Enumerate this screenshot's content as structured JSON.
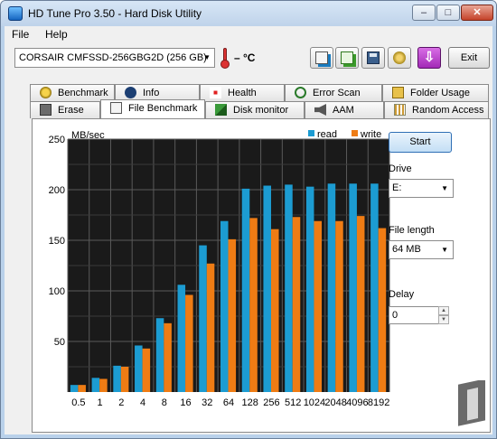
{
  "window": {
    "title": "HD Tune Pro 3.50 - Hard Disk Utility"
  },
  "menu": {
    "file": "File",
    "help": "Help"
  },
  "toolbar": {
    "drive": "CORSAIR CMFSSD-256GBG2D (256 GB)",
    "temperature": "– °C",
    "exit_label": "Exit"
  },
  "tabs_top": [
    {
      "label": "Benchmark",
      "icon": "benchmark-icon"
    },
    {
      "label": "Info",
      "icon": "info-icon"
    },
    {
      "label": "Health",
      "icon": "health-icon"
    },
    {
      "label": "Error Scan",
      "icon": "error-scan-icon"
    },
    {
      "label": "Folder Usage",
      "icon": "folder-icon"
    }
  ],
  "tabs_bottom": [
    {
      "label": "Erase",
      "icon": "erase-icon"
    },
    {
      "label": "File Benchmark",
      "icon": "file-benchmark-icon",
      "active": true
    },
    {
      "label": "Disk monitor",
      "icon": "disk-monitor-icon"
    },
    {
      "label": "AAM",
      "icon": "speaker-icon"
    },
    {
      "label": "Random Access",
      "icon": "random-access-icon"
    }
  ],
  "controls": {
    "start_label": "Start",
    "drive_label": "Drive",
    "drive_value": "E:",
    "file_length_label": "File length",
    "file_length_value": "64 MB",
    "delay_label": "Delay",
    "delay_value": "0"
  },
  "colors": {
    "read": "#1c9cd2",
    "write": "#ef7c14",
    "plot_bg": "#1a1a1a",
    "grid": "#5a5a5a"
  },
  "chart_data": {
    "type": "bar",
    "ylabel": "MB/sec",
    "ylim": [
      0,
      250
    ],
    "yticks": [
      50,
      100,
      150,
      200,
      250
    ],
    "grid": true,
    "legend": "top-right",
    "categories": [
      "0.5",
      "1",
      "2",
      "4",
      "8",
      "16",
      "32",
      "64",
      "128",
      "256",
      "512",
      "1024",
      "2048",
      "4096",
      "8192"
    ],
    "series": [
      {
        "name": "read",
        "color": "#1c9cd2",
        "values": [
          7,
          14,
          26,
          46,
          73,
          106,
          145,
          169,
          201,
          204,
          205,
          203,
          206,
          206,
          206
        ]
      },
      {
        "name": "write",
        "color": "#ef7c14",
        "values": [
          7,
          13,
          25,
          43,
          68,
          96,
          127,
          151,
          172,
          161,
          173,
          169,
          169,
          174,
          162
        ]
      }
    ]
  }
}
